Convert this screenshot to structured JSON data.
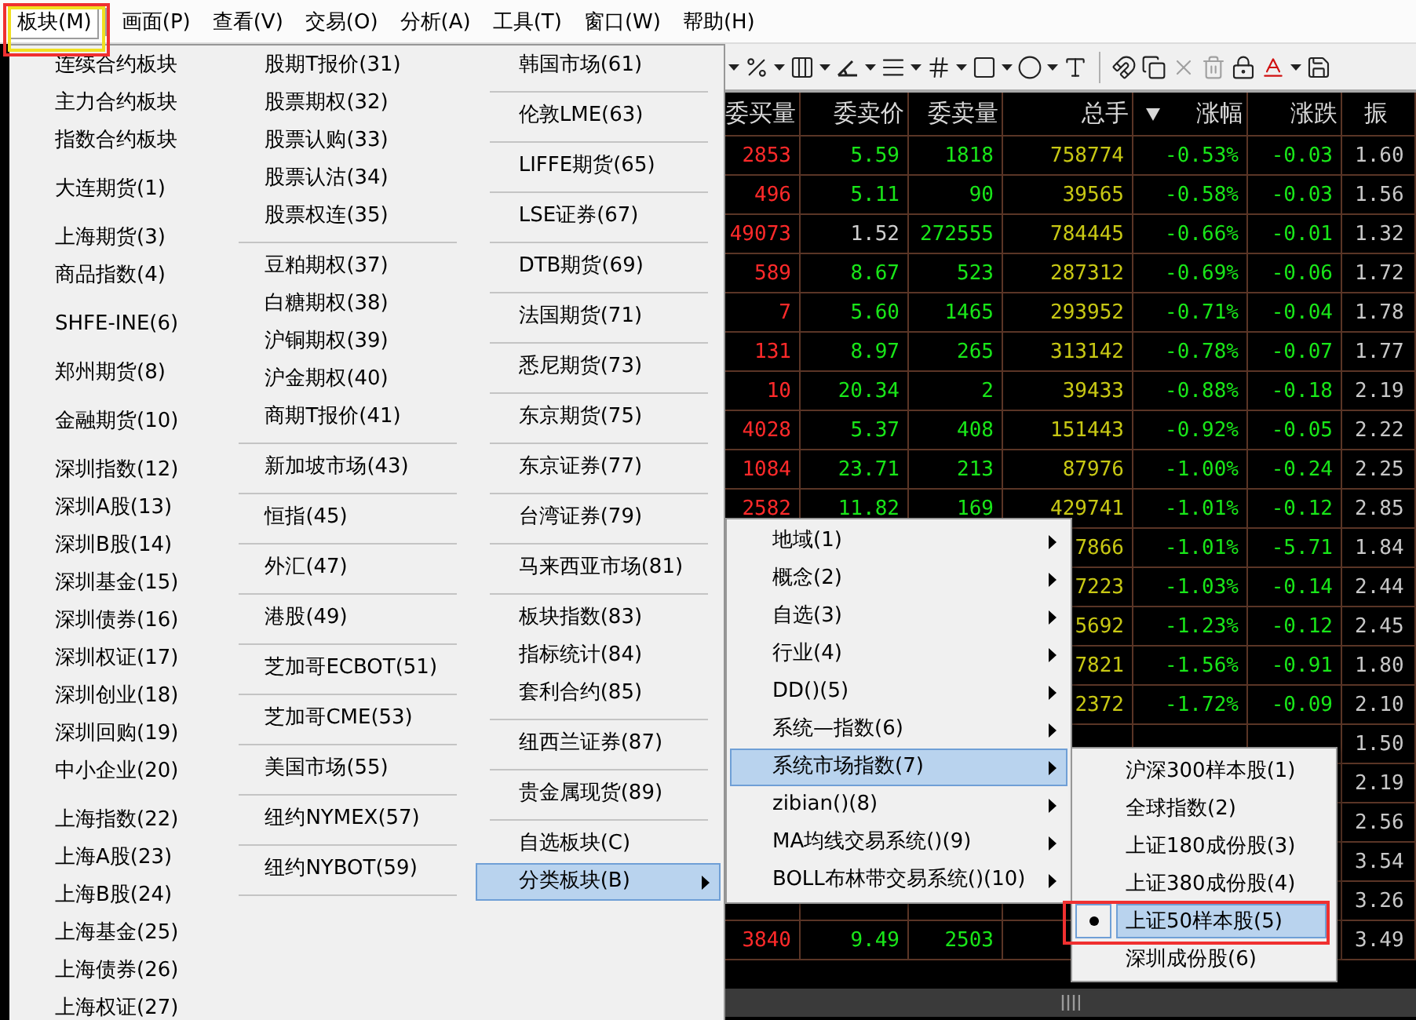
{
  "menubar": [
    {
      "label": "板块(M)",
      "selected": true
    },
    {
      "label": "画面(P)",
      "selected": false
    },
    {
      "label": "查看(V)",
      "selected": false
    },
    {
      "label": "交易(O)",
      "selected": false
    },
    {
      "label": "分析(A)",
      "selected": false
    },
    {
      "label": "工具(T)",
      "selected": false
    },
    {
      "label": "窗口(W)",
      "selected": false
    },
    {
      "label": "帮助(H)",
      "selected": false
    }
  ],
  "block_menu": {
    "columns": [
      {
        "groups": [
          [
            {
              "label": "连续合约板块",
              "selected": false
            },
            {
              "label": "主力合约板块",
              "selected": false
            },
            {
              "label": "指数合约板块",
              "selected": false
            }
          ],
          [
            {
              "label": "大连期货(1)",
              "selected": false
            }
          ],
          [
            {
              "label": "上海期货(3)",
              "selected": false
            },
            {
              "label": "商品指数(4)",
              "selected": false
            }
          ],
          [
            {
              "label": "SHFE-INE(6)",
              "selected": false
            }
          ],
          [
            {
              "label": "郑州期货(8)",
              "selected": false
            }
          ],
          [
            {
              "label": "金融期货(10)",
              "selected": false
            }
          ],
          [
            {
              "label": "深圳指数(12)",
              "selected": false
            },
            {
              "label": "深圳A股(13)",
              "selected": false
            },
            {
              "label": "深圳B股(14)",
              "selected": false
            },
            {
              "label": "深圳基金(15)",
              "selected": false
            },
            {
              "label": "深圳债券(16)",
              "selected": false
            },
            {
              "label": "深圳权证(17)",
              "selected": false
            },
            {
              "label": "深圳创业(18)",
              "selected": false
            },
            {
              "label": "深圳回购(19)",
              "selected": false
            },
            {
              "label": "中小企业(20)",
              "selected": false
            }
          ],
          [
            {
              "label": "上海指数(22)",
              "selected": false
            },
            {
              "label": "上海A股(23)",
              "selected": false
            },
            {
              "label": "上海B股(24)",
              "selected": false
            },
            {
              "label": "上海基金(25)",
              "selected": false
            },
            {
              "label": "上海债券(26)",
              "selected": false
            },
            {
              "label": "上海权证(27)",
              "selected": false
            }
          ]
        ]
      },
      {
        "groups": [
          [
            {
              "label": "股期T报价(31)",
              "selected": false
            },
            {
              "label": "股票期权(32)",
              "selected": false
            },
            {
              "label": "股票认购(33)",
              "selected": false
            },
            {
              "label": "股票认沽(34)",
              "selected": false
            },
            {
              "label": "股票权连(35)",
              "selected": false
            }
          ],
          [
            {
              "label": "豆粕期权(37)",
              "selected": false
            },
            {
              "label": "白糖期权(38)",
              "selected": false
            },
            {
              "label": "沪铜期权(39)",
              "selected": false
            },
            {
              "label": "沪金期权(40)",
              "selected": false
            },
            {
              "label": "商期T报价(41)",
              "selected": false
            }
          ],
          [
            {
              "label": "新加坡市场(43)",
              "selected": false
            }
          ],
          [
            {
              "label": "恒指(45)",
              "selected": false
            }
          ],
          [
            {
              "label": "外汇(47)",
              "selected": false
            }
          ],
          [
            {
              "label": "港股(49)",
              "selected": false
            }
          ],
          [
            {
              "label": "芝加哥ECBOT(51)",
              "selected": false
            }
          ],
          [
            {
              "label": "芝加哥CME(53)",
              "selected": false
            }
          ],
          [
            {
              "label": "美国市场(55)",
              "selected": false
            }
          ],
          [
            {
              "label": "纽约NYMEX(57)",
              "selected": false
            }
          ],
          [
            {
              "label": "纽约NYBOT(59)",
              "selected": false
            }
          ]
        ]
      },
      {
        "groups": [
          [
            {
              "label": "韩国市场(61)",
              "selected": false,
              "submenu": false
            }
          ],
          [
            {
              "label": "伦敦LME(63)",
              "selected": false,
              "submenu": false
            }
          ],
          [
            {
              "label": "LIFFE期货(65)",
              "selected": false,
              "submenu": false
            }
          ],
          [
            {
              "label": "LSE证券(67)",
              "selected": false,
              "submenu": false
            }
          ],
          [
            {
              "label": "DTB期货(69)",
              "selected": false,
              "submenu": false
            }
          ],
          [
            {
              "label": "法国期货(71)",
              "selected": false,
              "submenu": false
            }
          ],
          [
            {
              "label": "悉尼期货(73)",
              "selected": false,
              "submenu": false
            }
          ],
          [
            {
              "label": "东京期货(75)",
              "selected": false,
              "submenu": false
            }
          ],
          [
            {
              "label": "东京证券(77)",
              "selected": false,
              "submenu": false
            }
          ],
          [
            {
              "label": "台湾证券(79)",
              "selected": false,
              "submenu": false
            }
          ],
          [
            {
              "label": "马来西亚市场(81)",
              "selected": false,
              "submenu": false
            }
          ],
          [
            {
              "label": "板块指数(83)",
              "selected": false,
              "submenu": false
            },
            {
              "label": "指标统计(84)",
              "selected": false,
              "submenu": false
            },
            {
              "label": "套利合约(85)",
              "selected": false,
              "submenu": false
            }
          ],
          [
            {
              "label": "纽西兰证券(87)",
              "selected": false,
              "submenu": false
            }
          ],
          [
            {
              "label": "贵金属现货(89)",
              "selected": false,
              "submenu": false
            }
          ],
          [
            {
              "label": "自选板块(C)",
              "selected": false,
              "submenu": false
            },
            {
              "label": "分类板块(B)",
              "selected": true,
              "submenu": true
            }
          ]
        ]
      }
    ]
  },
  "category_submenu": [
    {
      "label": "地域(1)",
      "selected": false
    },
    {
      "label": "概念(2)",
      "selected": false
    },
    {
      "label": "自选(3)",
      "selected": false
    },
    {
      "label": "行业(4)",
      "selected": false
    },
    {
      "label": "DD()(5)",
      "selected": false
    },
    {
      "label": "系统—指数(6)",
      "selected": false
    },
    {
      "label": "系统市场指数(7)",
      "selected": true
    },
    {
      "label": "zibian()(8)",
      "selected": false
    },
    {
      "label": "MA均线交易系统()(9)",
      "selected": false
    },
    {
      "label": "BOLL布林带交易系统()(10)",
      "selected": false
    }
  ],
  "index_submenu": [
    {
      "label": "沪深300样本股(1)",
      "selected": false,
      "checked": false
    },
    {
      "label": "全球指数(2)",
      "selected": false,
      "checked": false
    },
    {
      "label": "上证180成份股(3)",
      "selected": false,
      "checked": false
    },
    {
      "label": "上证380成份股(4)",
      "selected": false,
      "checked": false
    },
    {
      "label": "上证50样本股(5)",
      "selected": true,
      "checked": true
    },
    {
      "label": "深圳成份股(6)",
      "selected": false,
      "checked": false
    }
  ],
  "quote_table": {
    "columns": [
      {
        "label": "委买量",
        "sorted": false
      },
      {
        "label": "委卖价",
        "sorted": false
      },
      {
        "label": "委卖量",
        "sorted": false
      },
      {
        "label": "总手",
        "sorted": false
      },
      {
        "label": "涨幅",
        "sorted": true
      },
      {
        "label": "涨跌",
        "sorted": false
      },
      {
        "label": "振",
        "sorted": false
      }
    ],
    "rows": [
      {
        "price_flat": false,
        "cells": [
          "2853",
          "5.59",
          "1818",
          "758774",
          "-0.53%",
          "-0.03",
          "1.60"
        ]
      },
      {
        "price_flat": false,
        "cells": [
          "496",
          "5.11",
          "90",
          "39565",
          "-0.58%",
          "-0.03",
          "1.56"
        ]
      },
      {
        "price_flat": true,
        "cells": [
          "49073",
          "1.52",
          "272555",
          "784445",
          "-0.66%",
          "-0.01",
          "1.32"
        ]
      },
      {
        "price_flat": false,
        "cells": [
          "589",
          "8.67",
          "523",
          "287312",
          "-0.69%",
          "-0.06",
          "1.72"
        ]
      },
      {
        "price_flat": false,
        "cells": [
          "7",
          "5.60",
          "1465",
          "293952",
          "-0.71%",
          "-0.04",
          "1.78"
        ]
      },
      {
        "price_flat": false,
        "cells": [
          "131",
          "8.97",
          "265",
          "313142",
          "-0.78%",
          "-0.07",
          "1.77"
        ]
      },
      {
        "price_flat": false,
        "cells": [
          "10",
          "20.34",
          "2",
          "39433",
          "-0.88%",
          "-0.18",
          "2.19"
        ]
      },
      {
        "price_flat": false,
        "cells": [
          "4028",
          "5.37",
          "408",
          "151443",
          "-0.92%",
          "-0.05",
          "2.22"
        ]
      },
      {
        "price_flat": false,
        "cells": [
          "1084",
          "23.71",
          "213",
          "87976",
          "-1.00%",
          "-0.24",
          "2.25"
        ]
      },
      {
        "price_flat": false,
        "cells": [
          "2582",
          "11.82",
          "169",
          "429741",
          "-1.01%",
          "-0.12",
          "2.85"
        ]
      },
      {
        "cells": [
          null,
          null,
          null,
          "7866",
          "-1.01%",
          "-5.71",
          "1.84"
        ]
      },
      {
        "cells": [
          null,
          null,
          null,
          "7223",
          "-1.03%",
          "-0.14",
          "2.44"
        ]
      },
      {
        "cells": [
          null,
          null,
          null,
          "5692",
          "-1.23%",
          "-0.12",
          "2.45"
        ]
      },
      {
        "cells": [
          null,
          null,
          null,
          "7821",
          "-1.56%",
          "-0.91",
          "1.80"
        ]
      },
      {
        "cells": [
          null,
          null,
          null,
          "2372",
          "-1.72%",
          "-0.09",
          "2.10"
        ]
      },
      {
        "cells": [
          null,
          null,
          null,
          null,
          null,
          null,
          "1.50"
        ]
      },
      {
        "cells": [
          null,
          null,
          null,
          null,
          null,
          null,
          "2.19"
        ]
      },
      {
        "cells": [
          null,
          null,
          null,
          null,
          null,
          null,
          "2.56"
        ]
      },
      {
        "cells": [
          null,
          null,
          null,
          null,
          null,
          null,
          "3.54"
        ]
      },
      {
        "cells": [
          null,
          null,
          null,
          null,
          null,
          null,
          "3.26"
        ]
      },
      {
        "price_flat": false,
        "cells": [
          "3840",
          "9.49",
          "2503",
          null,
          null,
          null,
          "3.49"
        ]
      }
    ]
  }
}
